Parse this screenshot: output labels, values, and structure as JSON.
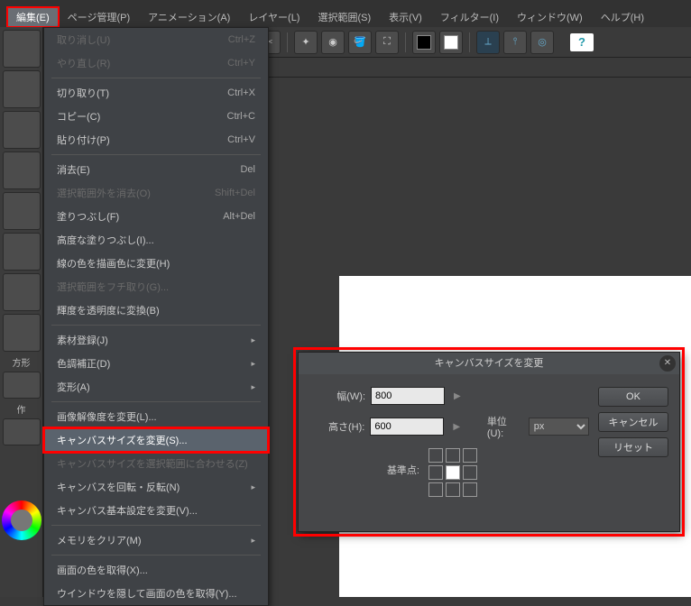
{
  "menubar": {
    "edit": "編集(E)",
    "page": "ページ管理(P)",
    "anim": "アニメーション(A)",
    "layer": "レイヤー(L)",
    "select": "選択範囲(S)",
    "view": "表示(V)",
    "filter": "フィルター(I)",
    "window": "ウィンドウ(W)",
    "help": "ヘルプ(H)"
  },
  "help_icon": "?",
  "tab": {
    "close": "×"
  },
  "sidebar": {
    "houkaku": "方形",
    "sakusei": "作"
  },
  "dropdown": {
    "undo": "取り消し(U)",
    "undo_sc": "Ctrl+Z",
    "redo": "やり直し(R)",
    "redo_sc": "Ctrl+Y",
    "cut": "切り取り(T)",
    "cut_sc": "Ctrl+X",
    "copy": "コピー(C)",
    "copy_sc": "Ctrl+C",
    "paste": "貼り付け(P)",
    "paste_sc": "Ctrl+V",
    "clear": "消去(E)",
    "clear_sc": "Del",
    "clear_out": "選択範囲外を消去(O)",
    "clear_out_sc": "Shift+Del",
    "fill": "塗りつぶし(F)",
    "fill_sc": "Alt+Del",
    "adv_fill": "高度な塗りつぶし(I)...",
    "line_to_draw": "線の色を描画色に変更(H)",
    "sel_border": "選択範囲をフチ取り(G)...",
    "bri_to_opa": "輝度を透明度に変換(B)",
    "mat_reg": "素材登録(J)",
    "tone_corr": "色調補正(D)",
    "transform": "変形(A)",
    "change_res": "画像解像度を変更(L)...",
    "canvas_size": "キャンバスサイズを変更(S)...",
    "canvas_to_sel": "キャンバスサイズを選択範囲に合わせる(Z)",
    "canvas_rotate": "キャンバスを回転・反転(N)",
    "canvas_basic": "キャンバス基本設定を変更(V)...",
    "mem_clear": "メモリをクリア(M)",
    "get_color": "画面の色を取得(X)...",
    "hide_get_color": "ウインドウを隠して画面の色を取得(Y)..."
  },
  "dialog": {
    "title": "キャンバスサイズを変更",
    "width_lbl": "幅(W):",
    "height_lbl": "高さ(H):",
    "width_val": "800",
    "height_val": "600",
    "unit_lbl": "単位(U):",
    "unit_val": "px",
    "anchor_lbl": "基準点:",
    "ok": "OK",
    "cancel": "キャンセル",
    "reset": "リセット",
    "close": "✕"
  }
}
